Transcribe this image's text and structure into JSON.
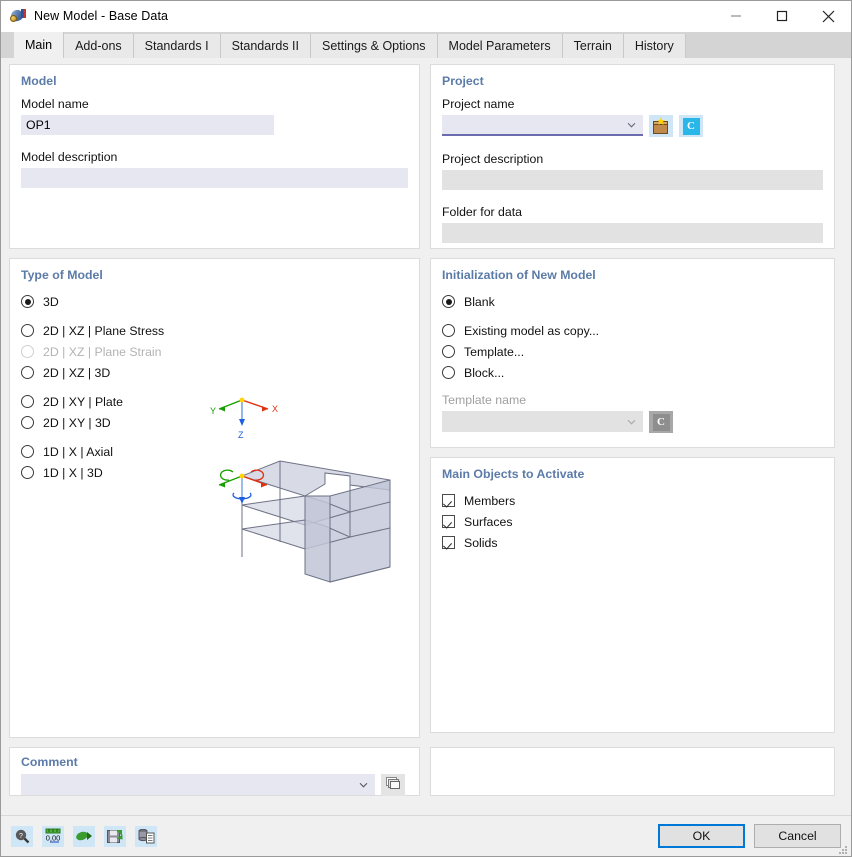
{
  "window": {
    "title": "New Model - Base Data",
    "icon": "rfem-model-icon",
    "minimize": "minimize-icon",
    "maximize": "maximize-icon",
    "close": "close-icon"
  },
  "tabs": [
    {
      "label": "Main",
      "active": true
    },
    {
      "label": "Add-ons",
      "active": false
    },
    {
      "label": "Standards I",
      "active": false
    },
    {
      "label": "Standards II",
      "active": false
    },
    {
      "label": "Settings & Options",
      "active": false
    },
    {
      "label": "Model Parameters",
      "active": false
    },
    {
      "label": "Terrain",
      "active": false
    },
    {
      "label": "History",
      "active": false
    }
  ],
  "model_group": {
    "title": "Model",
    "name_label": "Model name",
    "name_value": "OP1",
    "description_label": "Model description",
    "description_value": ""
  },
  "project_group": {
    "title": "Project",
    "name_label": "Project name",
    "name_value": "",
    "dropdown_icon": "chevron-down-icon",
    "new_project_icon": "package-star-icon",
    "cloud_icon": "c-badge-icon",
    "description_label": "Project description",
    "description_value": "",
    "folder_label": "Folder for data",
    "folder_value": ""
  },
  "type_of_model": {
    "title": "Type of Model",
    "options": [
      {
        "label": "3D",
        "checked": true,
        "disabled": false,
        "gap_after": true
      },
      {
        "label": "2D | XZ | Plane Stress",
        "checked": false,
        "disabled": false,
        "gap_after": false
      },
      {
        "label": "2D | XZ | Plane Strain",
        "checked": false,
        "disabled": true,
        "gap_after": false
      },
      {
        "label": "2D | XZ | 3D",
        "checked": false,
        "disabled": false,
        "gap_after": true
      },
      {
        "label": "2D | XY | Plate",
        "checked": false,
        "disabled": false,
        "gap_after": false
      },
      {
        "label": "2D | XY | 3D",
        "checked": false,
        "disabled": false,
        "gap_after": true
      },
      {
        "label": "1D | X | Axial",
        "checked": false,
        "disabled": false,
        "gap_after": false
      },
      {
        "label": "1D | X | 3D",
        "checked": false,
        "disabled": false,
        "gap_after": false
      }
    ],
    "axes": {
      "x": "X",
      "y": "Y",
      "z": "Z"
    },
    "preview_name": "model-preview-3d"
  },
  "initialization": {
    "title": "Initialization of New Model",
    "options": [
      {
        "label": "Blank",
        "checked": true,
        "gap_after": true
      },
      {
        "label": "Existing model as copy...",
        "checked": false,
        "gap_after": false
      },
      {
        "label": "Template...",
        "checked": false,
        "gap_after": false
      },
      {
        "label": "Block...",
        "checked": false,
        "gap_after": false
      }
    ],
    "template_label": "Template name",
    "template_value": "",
    "template_dropdown_icon": "chevron-down-icon",
    "template_browse_icon": "c-badge-icon"
  },
  "main_objects": {
    "title": "Main Objects to Activate",
    "items": [
      {
        "label": "Members",
        "checked": true
      },
      {
        "label": "Surfaces",
        "checked": true
      },
      {
        "label": "Solids",
        "checked": true
      }
    ]
  },
  "comment_group": {
    "title": "Comment",
    "value": "",
    "dropdown_icon": "chevron-down-icon",
    "pick_icon": "comment-list-icon"
  },
  "footer": {
    "icons": [
      {
        "name": "help-magnifier-icon"
      },
      {
        "name": "units-0-00-icon",
        "label": "0,00"
      },
      {
        "name": "green-arrow-icon"
      },
      {
        "name": "save-defaults-icon"
      },
      {
        "name": "database-export-icon"
      }
    ],
    "ok_label": "OK",
    "cancel_label": "Cancel",
    "resize_grip": "resize-grip-icon"
  },
  "colors": {
    "group_title": "#5b7ba8",
    "input_bg": "#e7e7f2",
    "input_disabled_bg": "#e2e2e2",
    "combo_underline": "#6b6bb0",
    "accent_button": "#0078d7",
    "axis_x": "#e03010",
    "axis_y": "#18a000",
    "axis_z": "#2060e0",
    "model_fill": "#c9cddd"
  }
}
